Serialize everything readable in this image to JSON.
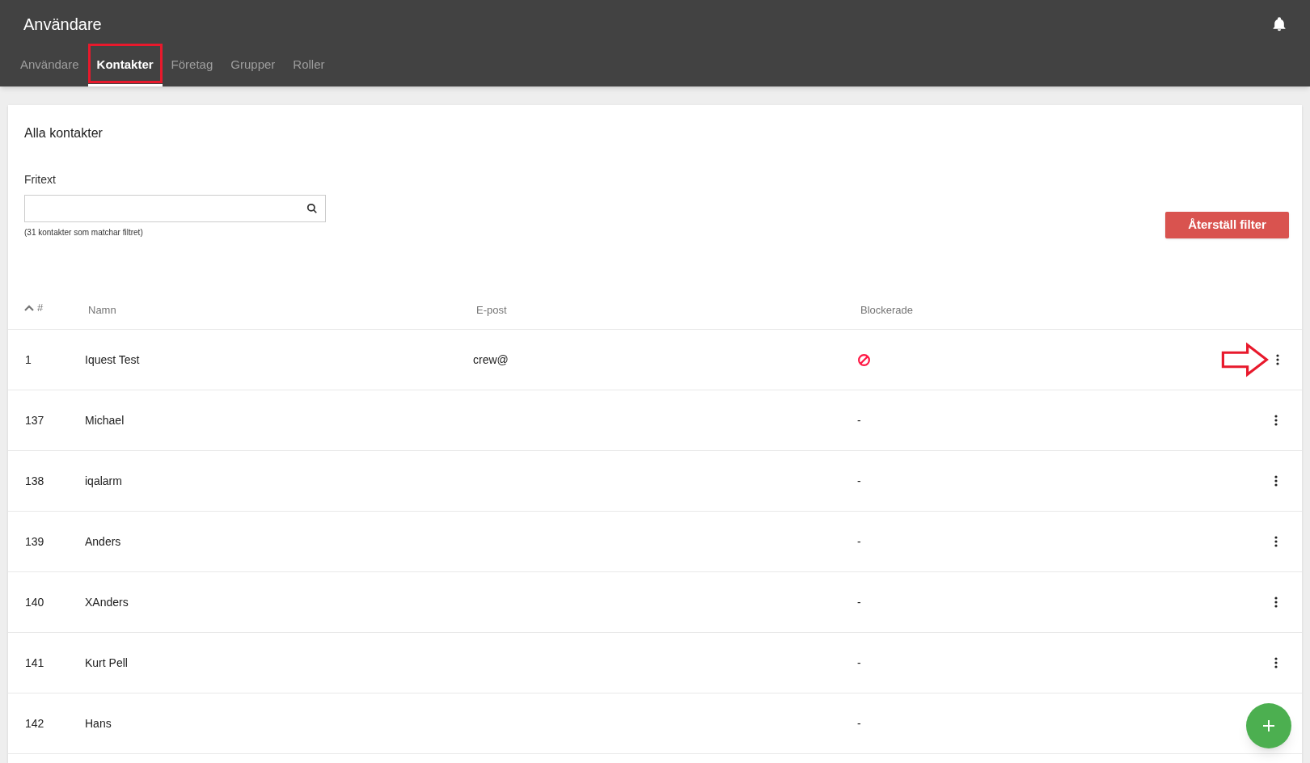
{
  "header": {
    "title": "Användare"
  },
  "tabs": [
    {
      "label": "Användare",
      "selected": false,
      "highlighted": false
    },
    {
      "label": "Kontakter",
      "selected": true,
      "highlighted": true
    },
    {
      "label": "Företag",
      "selected": false,
      "highlighted": false
    },
    {
      "label": "Grupper",
      "selected": false,
      "highlighted": false
    },
    {
      "label": "Roller",
      "selected": false,
      "highlighted": false
    }
  ],
  "card": {
    "title": "Alla kontakter",
    "filter_label": "Fritext",
    "match_count": "(31 kontakter som matchar filtret)",
    "reset_button": "Återställ filter"
  },
  "table": {
    "columns": [
      "#",
      "Namn",
      "E-post",
      "Blockerade"
    ],
    "rows": [
      {
        "id": "1",
        "name": "Iquest Test",
        "email": "crew@",
        "blocked": true,
        "pointed": true
      },
      {
        "id": "137",
        "name": "Michael",
        "blocked": false,
        "blocked_text": "-",
        "pointed": false
      },
      {
        "id": "138",
        "name": "iqalarm",
        "blocked": false,
        "blocked_text": "-",
        "pointed": false
      },
      {
        "id": "139",
        "name": "Anders",
        "blocked": false,
        "blocked_text": "-",
        "pointed": false
      },
      {
        "id": "140",
        "name": "XAnders",
        "blocked": false,
        "blocked_text": "-",
        "pointed": false
      },
      {
        "id": "141",
        "name": "Kurt Pell",
        "blocked": false,
        "blocked_text": "-",
        "pointed": false
      },
      {
        "id": "142",
        "name": "Hans",
        "blocked": false,
        "blocked_text": "-",
        "pointed": false
      }
    ]
  }
}
